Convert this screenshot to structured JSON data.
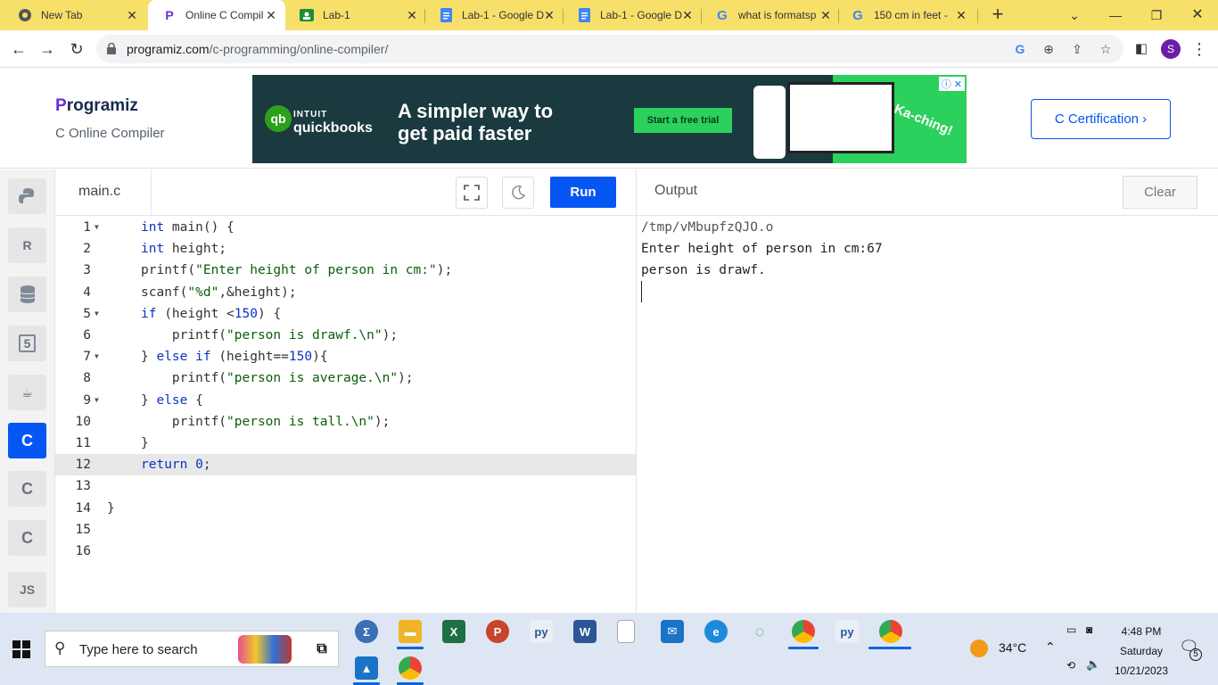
{
  "browser": {
    "tabs": [
      {
        "title": "New Tab",
        "icon": "chrome-icon",
        "active": false
      },
      {
        "title": "Online C Compil",
        "icon": "programiz-icon",
        "active": true
      },
      {
        "title": "Lab-1",
        "icon": "classroom-icon",
        "active": false
      },
      {
        "title": "Lab-1 - Google D",
        "icon": "google-docs-icon",
        "active": false
      },
      {
        "title": "Lab-1 - Google D",
        "icon": "google-docs-icon",
        "active": false
      },
      {
        "title": "what is formatsp",
        "icon": "google-icon",
        "active": false
      },
      {
        "title": "150 cm in feet -",
        "icon": "google-icon",
        "active": false
      }
    ],
    "url_host": "programiz.com",
    "url_path": "/c-programming/online-compiler/",
    "profile_initial": "S",
    "accent": "#f7e06a"
  },
  "site": {
    "logo_p": "P",
    "logo_rest": "rogramiz",
    "subtitle": "C Online Compiler",
    "cert_button": "C Certification ›",
    "ad": {
      "brand_top": "INTUIT",
      "brand_bottom": "quickbooks",
      "headline_1": "A simpler way to",
      "headline_2": "get paid faster",
      "cta": "Start a free trial",
      "tagline": "Ka-ching!"
    }
  },
  "editor": {
    "file_tab": "main.c",
    "run_label": "Run",
    "current_line": 12,
    "lines": [
      {
        "n": "1",
        "fold": true,
        "text": "int main() {"
      },
      {
        "n": "2",
        "fold": false,
        "text": "    int height;"
      },
      {
        "n": "3",
        "fold": false,
        "text": "    printf(\"Enter height of person in cm:\");"
      },
      {
        "n": "4",
        "fold": false,
        "text": "    scanf(\"%d\",&height);"
      },
      {
        "n": "5",
        "fold": true,
        "text": "    if (height <150) {"
      },
      {
        "n": "6",
        "fold": false,
        "text": "        printf(\"person is drawf.\\n\");"
      },
      {
        "n": "7",
        "fold": true,
        "text": "    } else if (height==150){"
      },
      {
        "n": "8",
        "fold": false,
        "text": "        printf(\"person is average.\\n\");"
      },
      {
        "n": "9",
        "fold": true,
        "text": "    } else {"
      },
      {
        "n": "10",
        "fold": false,
        "text": "        printf(\"person is tall.\\n\");"
      },
      {
        "n": "11",
        "fold": false,
        "text": "    }"
      },
      {
        "n": "12",
        "fold": false,
        "text": "    return 0;"
      },
      {
        "n": "13",
        "fold": false,
        "text": ""
      },
      {
        "n": "14",
        "fold": false,
        "text": "}"
      },
      {
        "n": "15",
        "fold": false,
        "text": ""
      },
      {
        "n": "16",
        "fold": false,
        "text": ""
      }
    ]
  },
  "output": {
    "label": "Output",
    "clear_label": "Clear",
    "lines": [
      "/tmp/vMbupfzQJO.o",
      "Enter height of person in cm:67",
      "person is drawf."
    ]
  },
  "rail": {
    "items": [
      {
        "name": "python-icon",
        "label": "",
        "active": false
      },
      {
        "name": "r-language-icon",
        "label": "R",
        "active": false
      },
      {
        "name": "sql-database-icon",
        "label": "",
        "active": false
      },
      {
        "name": "html5-icon",
        "label": "5",
        "active": false
      },
      {
        "name": "java-icon",
        "label": "",
        "active": false
      },
      {
        "name": "c-language-icon",
        "label": "C",
        "active": true
      },
      {
        "name": "cpp-icon",
        "label": "C",
        "active": false
      },
      {
        "name": "csharp-icon",
        "label": "C",
        "active": false
      },
      {
        "name": "javascript-icon",
        "label": "JS",
        "active": false
      }
    ]
  },
  "taskbar": {
    "search_placeholder": "Type here to search",
    "weather": "34°C",
    "time": "4:48 PM",
    "day": "Saturday",
    "date": "10/21/2023",
    "notifications": "5"
  }
}
